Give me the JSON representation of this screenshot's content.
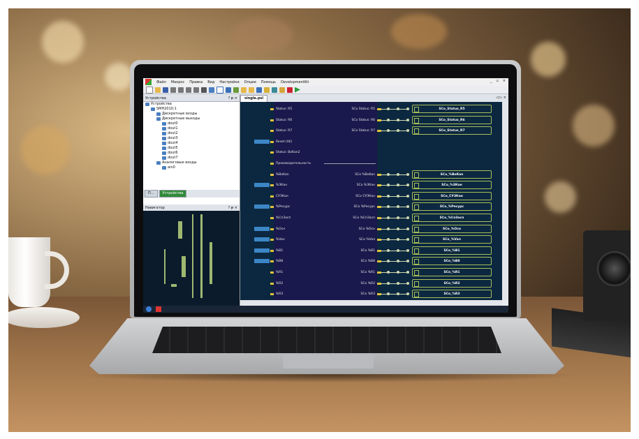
{
  "app": {
    "menu": [
      "Файл",
      "Макрос",
      "Правка",
      "Вид",
      "Настройки",
      "Опции",
      "Помощь",
      "DevelopmentKit"
    ],
    "window_controls": [
      "_",
      "▫",
      "×"
    ],
    "left_panel_title": "Устройства",
    "panel_controls": "? ᵽ ×",
    "tree": [
      {
        "label": "Устройства",
        "depth": 0
      },
      {
        "label": "SMH2010:1",
        "depth": 1
      },
      {
        "label": "Дискретные входы",
        "depth": 2
      },
      {
        "label": "Дискретные выходы",
        "depth": 2
      },
      {
        "label": "dout0",
        "depth": 3
      },
      {
        "label": "dout1",
        "depth": 3
      },
      {
        "label": "dout2",
        "depth": 3
      },
      {
        "label": "dout3",
        "depth": 3
      },
      {
        "label": "dout4",
        "depth": 3
      },
      {
        "label": "dout5",
        "depth": 3
      },
      {
        "label": "dout6",
        "depth": 3
      },
      {
        "label": "dout7",
        "depth": 3
      },
      {
        "label": "Аналоговые входы",
        "depth": 2
      },
      {
        "label": "ain0",
        "depth": 3
      }
    ],
    "left_tabs": [
      "П...",
      "Устройства"
    ],
    "navigator_title": "Навигатор",
    "doc_tab": "single.psl",
    "doc_controls": "◁ ▷ ×",
    "rows": [
      {
        "in": "Status: R5",
        "out": "SCo Status: R5",
        "box": "SCo_Status_R5",
        "tag": false
      },
      {
        "in": "Status: R6",
        "out": "SCo Status: R6",
        "box": "SCo_Status_R6",
        "tag": false
      },
      {
        "in": "Status: R7",
        "out": "SCo Status: R7",
        "box": "SCo_Status_R7",
        "tag": false
      },
      {
        "in": "Reset (All)",
        "out": "",
        "box": "",
        "tag": true
      },
      {
        "in": "Status: BoKan2",
        "out": "",
        "box": "",
        "tag": false
      },
      {
        "in": "Производительность",
        "out": "",
        "box": "",
        "tag": false,
        "sep": true
      },
      {
        "in": "%BoKan",
        "out": "SCo %BoKan",
        "box": "SCo_%BoKan",
        "tag": false
      },
      {
        "in": "%ЗКан",
        "out": "SCo %ЗКан",
        "box": "SCo_%ЗКан",
        "tag": true
      },
      {
        "in": "CУЗКан",
        "out": "SCo CУЗКан",
        "box": "SCo_CУЗКан",
        "tag": false
      },
      {
        "in": "%Ресурс",
        "out": "SCo %Ресурс",
        "box": "SCo_%Ресурс",
        "tag": true
      },
      {
        "in": "%Сп3асп",
        "out": "SCo %Сп3асп",
        "box": "SCo_%Сп3асп",
        "tag": false
      },
      {
        "in": "%Осн",
        "out": "SCo %Осн",
        "box": "SCo_%Осн",
        "tag": true
      },
      {
        "in": "%Vaл",
        "out": "SCo %Vaл",
        "box": "SCo_%Vaл",
        "tag": true
      },
      {
        "in": "%B1",
        "out": "SCo %B1",
        "box": "SCo_%B1",
        "tag": true
      },
      {
        "in": "%B8",
        "out": "SCo %B8",
        "box": "SCo_%B8",
        "tag": true
      },
      {
        "in": "%R1",
        "out": "SCo %R1",
        "box": "SCo_%R1",
        "tag": false
      },
      {
        "in": "%R2",
        "out": "SCo %R2",
        "box": "SCo_%R2",
        "tag": false
      },
      {
        "in": "%R3",
        "out": "SCo %R3",
        "box": "SCo_%R3",
        "tag": false
      }
    ]
  }
}
